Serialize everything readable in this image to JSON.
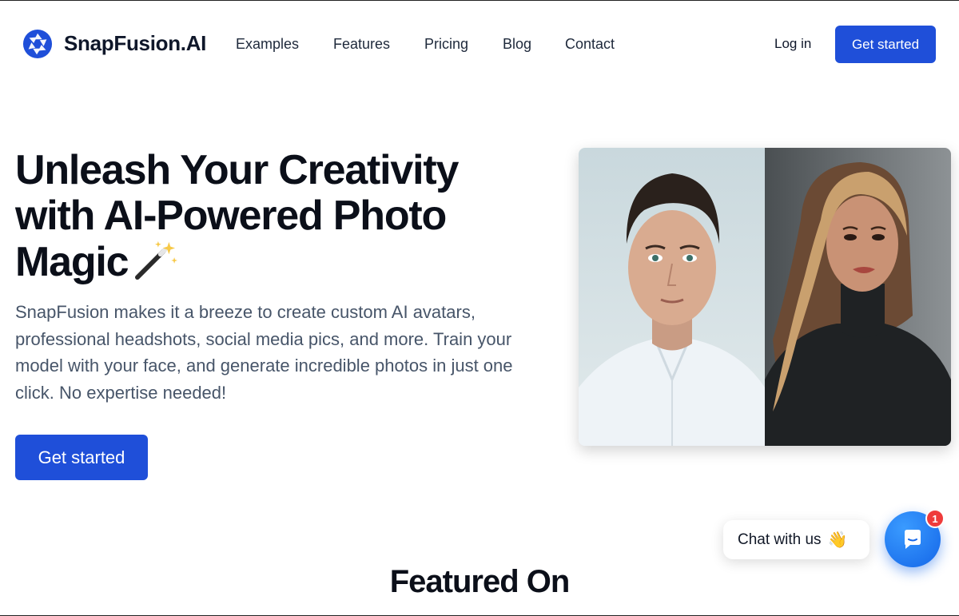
{
  "header": {
    "brand": "SnapFusion.AI",
    "logo_icon": "camera-aperture-icon",
    "nav": [
      "Examples",
      "Features",
      "Pricing",
      "Blog",
      "Contact"
    ],
    "login_label": "Log in",
    "cta_label": "Get started"
  },
  "hero": {
    "headline_lines": [
      "Unleash Your Creativity",
      "with AI-Powered Photo",
      "Magic"
    ],
    "headline_icon": "magic-wand-icon",
    "description": "SnapFusion makes it a breeze to create custom AI avatars, professional headshots, social media pics, and more. Train your model with your face, and generate incredible photos in just one click. No expertise needed!",
    "cta_label": "Get started",
    "images": [
      "man-headshot",
      "woman-headshot"
    ]
  },
  "featured": {
    "title": "Featured On"
  },
  "chat": {
    "prompt": "Chat with us",
    "wave_icon": "waving-hand-icon",
    "button_icon": "chat-icon",
    "badge_count": "1"
  },
  "colors": {
    "primary": "#1f4fd9",
    "chat_blue": "#1466e8",
    "badge_red": "#ef3b3b"
  }
}
